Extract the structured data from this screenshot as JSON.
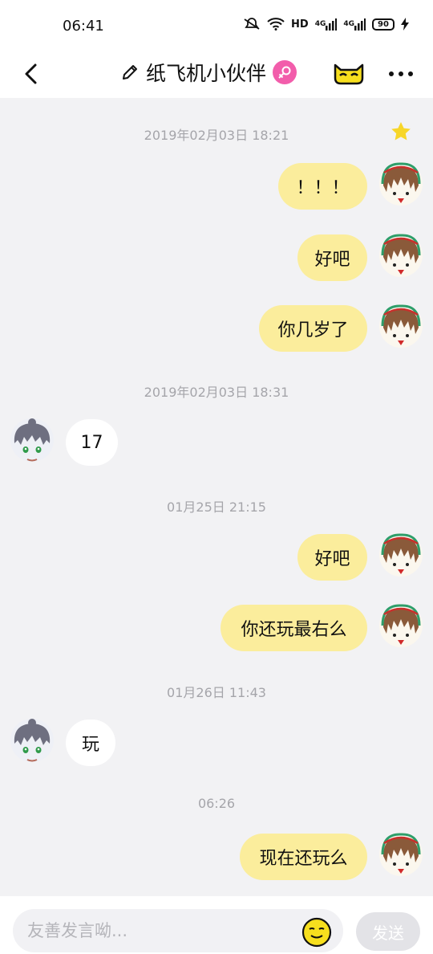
{
  "status_bar": {
    "time": "06:41",
    "network_label": "HD",
    "signal1_label": "4G",
    "signal2_label": "4G",
    "battery": "90"
  },
  "header": {
    "title": "纸飞机小伙伴",
    "gender": "female",
    "accent_color": "#f25dab"
  },
  "messages": [
    {
      "kind": "timestamp",
      "text": "2019年02月03日 18:21"
    },
    {
      "kind": "message",
      "from": "me",
      "text": "！！！"
    },
    {
      "kind": "message",
      "from": "me",
      "text": "好吧"
    },
    {
      "kind": "message",
      "from": "me",
      "text": "你几岁了"
    },
    {
      "kind": "timestamp",
      "text": "2019年02月03日 18:31"
    },
    {
      "kind": "message",
      "from": "them",
      "text": "17"
    },
    {
      "kind": "timestamp",
      "text": "01月25日 21:15"
    },
    {
      "kind": "message",
      "from": "me",
      "text": "好吧"
    },
    {
      "kind": "message",
      "from": "me",
      "text": "你还玩最右么"
    },
    {
      "kind": "timestamp",
      "text": "01月26日 11:43"
    },
    {
      "kind": "message",
      "from": "them",
      "text": "玩"
    },
    {
      "kind": "timestamp",
      "text": "06:26"
    },
    {
      "kind": "message",
      "from": "me",
      "text": "现在还玩么"
    }
  ],
  "input": {
    "placeholder": "友善发言呦...",
    "value": "",
    "send_label": "发送"
  },
  "colors": {
    "my_bubble": "#fbed9c",
    "their_bubble": "#ffffff",
    "background": "#f2f2f4",
    "star": "#f7d629"
  }
}
